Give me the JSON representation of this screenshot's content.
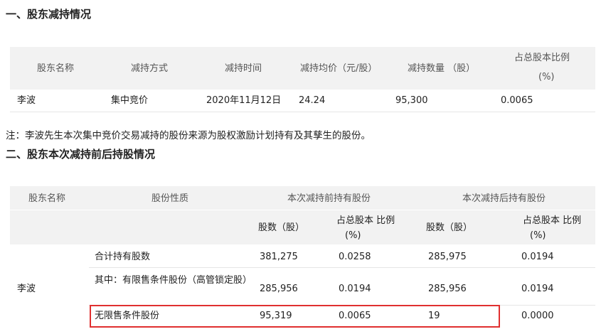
{
  "section1": {
    "title": "一、股东减持情况",
    "headers": [
      "股东名称",
      "减持方式",
      "减持时间",
      "减持均价（元/股）",
      "减持数量 （股）",
      "占总股本比例",
      "(%)"
    ],
    "row": [
      "李波",
      "集中竞价",
      "2020年11月12日",
      "24.24",
      "95,300",
      "0.0065"
    ]
  },
  "note": "注：李波先生本次集中竞价交易减持的股份来源为股权激励计划持有及其孳生的股份。",
  "section2": {
    "title": "二、股东本次减持前后持股情况",
    "header_top": [
      "股东名称",
      "股份性质",
      "本次减持前持有股份",
      "本次减持后持有股份"
    ],
    "sub_headers": [
      "股数（股）",
      "占总股本 比例",
      "(%)",
      "股数（股）",
      "占总股本 比例",
      "(%)"
    ],
    "holder": "李波",
    "rows": [
      {
        "type": "合计持有股数",
        "before_shares": "381,275",
        "before_pct": "0.0258",
        "after_shares": "285,975",
        "after_pct": "0.0194"
      },
      {
        "type": "其中：有限售条件股份（高管锁定股）",
        "before_shares": "285,956",
        "before_pct": "0.0194",
        "after_shares": "285,956",
        "after_pct": "0.0194"
      },
      {
        "type": "无限售条件股份",
        "before_shares": "95,319",
        "before_pct": "0.0065",
        "after_shares": "19",
        "after_pct": "0.0000"
      }
    ]
  },
  "colors": {
    "header_bg": "#f2f2f2",
    "highlight_border": "#e03030"
  }
}
